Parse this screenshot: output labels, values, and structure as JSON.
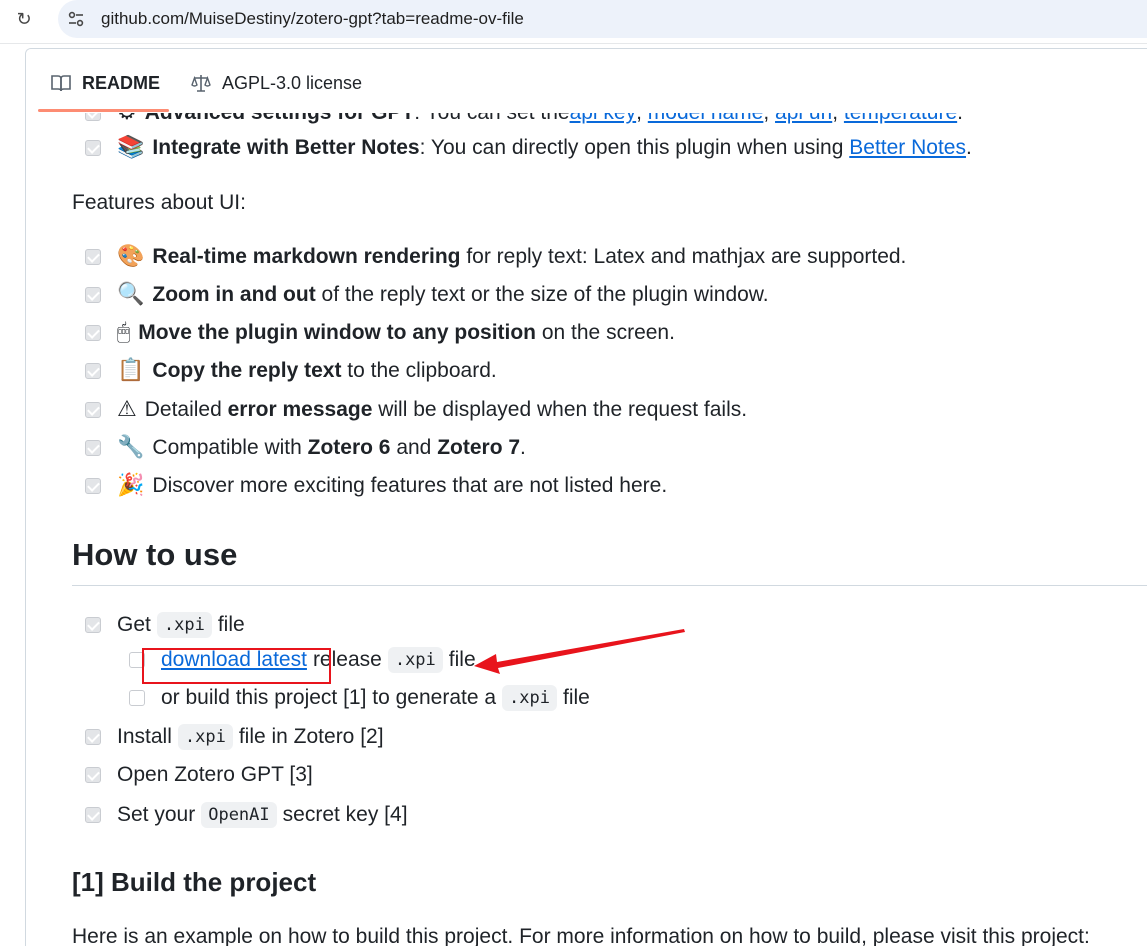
{
  "browser": {
    "url": "github.com/MuiseDestiny/zotero-gpt?tab=readme-ov-file",
    "reload_icon": "reload-icon",
    "site_info_icon": "tune-icon"
  },
  "tabs": {
    "readme": "README",
    "license": "AGPL-3.0 license",
    "active_accent": "#fd8c73"
  },
  "partial_top": {
    "bold": "Advanced settings for GPT",
    "text": ": You can set the ",
    "links": [
      "api key",
      "model name",
      "api url",
      "temperature"
    ]
  },
  "better_notes": {
    "emoji": "📚",
    "bold": "Integrate with Better Notes",
    "text": ": You can directly open this plugin when using ",
    "link": "Better Notes",
    "end": "."
  },
  "ui_heading": "Features about UI:",
  "ui_features": [
    {
      "emoji": "🎨",
      "bold": "Real-time markdown rendering",
      "after": " for reply text: Latex and mathjax are supported."
    },
    {
      "emoji": "🔍",
      "bold": "Zoom in and out",
      "after": " of the reply text or the size of the plugin window."
    },
    {
      "emoji": "🖱",
      "bold": "Move the plugin window to any position",
      "after": " on the screen."
    },
    {
      "emoji": "📋",
      "bold": "Copy the reply text",
      "after": " to the clipboard."
    },
    {
      "emoji": "⚠",
      "before": "Detailed ",
      "bold": "error message",
      "after": " will be displayed when the request fails."
    },
    {
      "emoji": "🔧",
      "before": "Compatible with ",
      "bold": "Zotero 6",
      "mid": " and ",
      "bold2": "Zotero 7",
      "after": "."
    },
    {
      "emoji": "🎉",
      "before": "Discover more exciting features that are not listed here."
    }
  ],
  "how_to_use": {
    "title": "How to use",
    "get": {
      "before": "Get",
      "code": ".xpi",
      "after": "file"
    },
    "download": {
      "link": "download latest",
      "text": "release",
      "code": ".xpi",
      "after": "file"
    },
    "build": {
      "before": "or build this project [1] to generate a",
      "code": ".xpi",
      "after": "file"
    },
    "install": {
      "before": "Install",
      "code": ".xpi",
      "after": "file in Zotero [2]"
    },
    "open": "Open Zotero GPT [3]",
    "set": {
      "before": "Set your",
      "code": "OpenAI",
      "after": "secret key [4]"
    }
  },
  "build_section": {
    "title": "[1] Build the project",
    "intro": "Here is an example on how to build this project. For more information on how to build, please visit this project:"
  },
  "annotation_color": "#e8141c",
  "link_color": "#0969da"
}
